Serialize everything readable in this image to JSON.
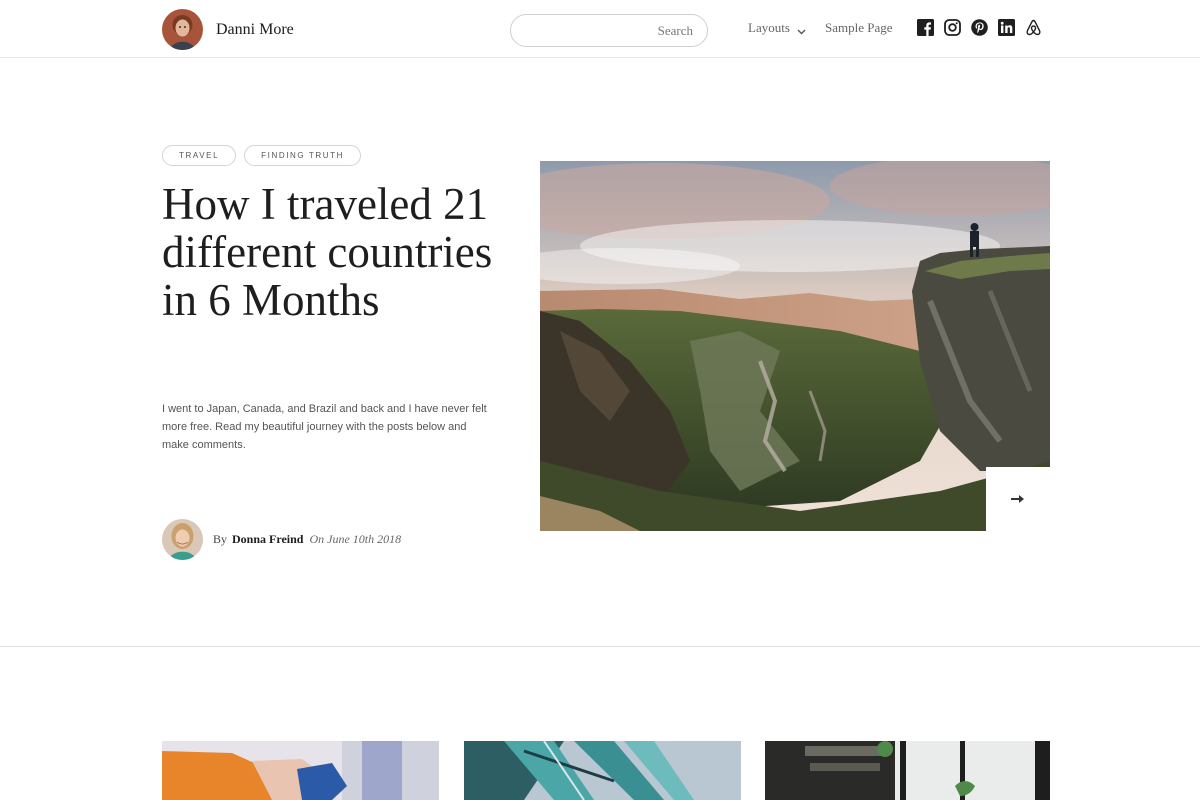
{
  "header": {
    "site_name": "Danni More",
    "search": {
      "placeholder": "Search",
      "value": ""
    },
    "nav": [
      {
        "label": "Layouts",
        "has_dropdown": true
      },
      {
        "label": "Sample Page",
        "has_dropdown": false
      }
    ],
    "socials": [
      "facebook-icon",
      "instagram-icon",
      "pinterest-icon",
      "linkedin-icon",
      "airbnb-icon"
    ]
  },
  "post": {
    "tags": [
      "TRAVEL",
      "FINDING TRUTH"
    ],
    "title": "How I traveled 21 different countries in 6 Months",
    "excerpt": "I went to Japan, Canada, and Brazil and back and I have never felt more free. Read my beautiful journey with the posts below and make comments.",
    "byline": {
      "by": "By",
      "author": "Donna Freind",
      "date": "On June 10th 2018"
    }
  },
  "colors": {
    "text": "#1e1e1e",
    "muted": "#666666",
    "border": "#e3e3e3"
  }
}
